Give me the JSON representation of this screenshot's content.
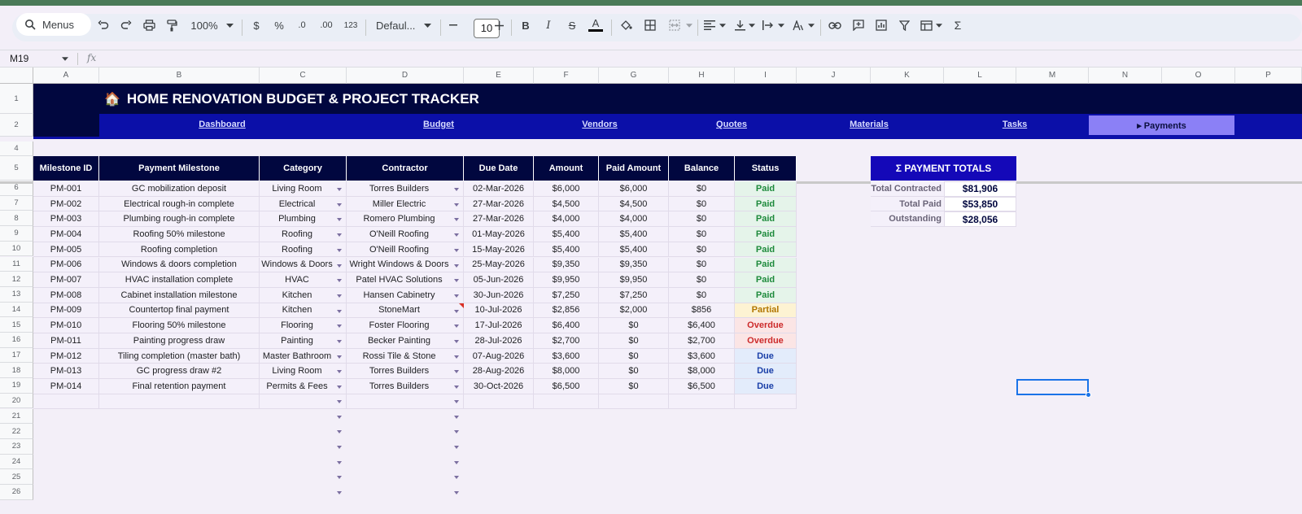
{
  "toolbar": {
    "menus_label": "Menus",
    "zoom": "100%",
    "currency": "$",
    "percent": "%",
    "dec_less": ".0",
    "dec_more": ".00",
    "format_123": "123",
    "font": "Defaul...",
    "font_size": "10",
    "bold": "B",
    "italic": "I",
    "strike": "S",
    "text_color": "A",
    "sum": "Σ"
  },
  "name_box": "M19",
  "fx_label": "fx",
  "columns": [
    "A",
    "B",
    "C",
    "D",
    "E",
    "F",
    "G",
    "H",
    "I",
    "J",
    "K",
    "L",
    "M",
    "N",
    "O",
    "P"
  ],
  "rows": [
    "1",
    "2",
    "4",
    "5",
    "6",
    "7",
    "8",
    "9",
    "10",
    "11",
    "12",
    "13",
    "14",
    "15",
    "16",
    "17",
    "18",
    "19",
    "20",
    "21",
    "22",
    "23",
    "24",
    "25",
    "26"
  ],
  "title": "HOME RENOVATION BUDGET & PROJECT TRACKER",
  "title_emoji": "🏠",
  "nav": {
    "links": [
      "Dashboard",
      "Budget",
      "Vendors",
      "Quotes",
      "Materials",
      "Tasks"
    ],
    "active": "▸ Payments"
  },
  "table": {
    "headers": [
      "Milestone ID",
      "Payment Milestone",
      "Category",
      "Contractor",
      "Due Date",
      "Amount",
      "Paid Amount",
      "Balance",
      "Status"
    ],
    "rows": [
      [
        "PM-001",
        "GC mobilization deposit",
        "Living Room",
        "Torres Builders",
        "02-Mar-2026",
        "$6,000",
        "$6,000",
        "$0",
        "Paid"
      ],
      [
        "PM-002",
        "Electrical rough-in complete",
        "Electrical",
        "Miller Electric",
        "27-Mar-2026",
        "$4,500",
        "$4,500",
        "$0",
        "Paid"
      ],
      [
        "PM-003",
        "Plumbing rough-in complete",
        "Plumbing",
        "Romero Plumbing",
        "27-Mar-2026",
        "$4,000",
        "$4,000",
        "$0",
        "Paid"
      ],
      [
        "PM-004",
        "Roofing 50% milestone",
        "Roofing",
        "O'Neill Roofing",
        "01-May-2026",
        "$5,400",
        "$5,400",
        "$0",
        "Paid"
      ],
      [
        "PM-005",
        "Roofing completion",
        "Roofing",
        "O'Neill Roofing",
        "15-May-2026",
        "$5,400",
        "$5,400",
        "$0",
        "Paid"
      ],
      [
        "PM-006",
        "Windows & doors completion",
        "Windows & Doors",
        "Wright Windows & Doors",
        "25-May-2026",
        "$9,350",
        "$9,350",
        "$0",
        "Paid"
      ],
      [
        "PM-007",
        "HVAC installation complete",
        "HVAC",
        "Patel HVAC Solutions",
        "05-Jun-2026",
        "$9,950",
        "$9,950",
        "$0",
        "Paid"
      ],
      [
        "PM-008",
        "Cabinet installation milestone",
        "Kitchen",
        "Hansen Cabinetry",
        "30-Jun-2026",
        "$7,250",
        "$7,250",
        "$0",
        "Paid"
      ],
      [
        "PM-009",
        "Countertop final payment",
        "Kitchen",
        "StoneMart",
        "10-Jul-2026",
        "$2,856",
        "$2,000",
        "$856",
        "Partial"
      ],
      [
        "PM-010",
        "Flooring 50% milestone",
        "Flooring",
        "Foster Flooring",
        "17-Jul-2026",
        "$6,400",
        "$0",
        "$6,400",
        "Overdue"
      ],
      [
        "PM-011",
        "Painting progress draw",
        "Painting",
        "Becker Painting",
        "28-Jul-2026",
        "$2,700",
        "$0",
        "$2,700",
        "Overdue"
      ],
      [
        "PM-012",
        "Tiling completion (master bath)",
        "Master Bathroom",
        "Rossi Tile & Stone",
        "07-Aug-2026",
        "$3,600",
        "$0",
        "$3,600",
        "Due"
      ],
      [
        "PM-013",
        "GC progress draw #2",
        "Living Room",
        "Torres Builders",
        "28-Aug-2026",
        "$8,000",
        "$0",
        "$8,000",
        "Due"
      ],
      [
        "PM-014",
        "Final retention payment",
        "Permits & Fees",
        "Torres Builders",
        "30-Oct-2026",
        "$6,500",
        "$0",
        "$6,500",
        "Due"
      ]
    ]
  },
  "totals": {
    "header": "Σ PAYMENT TOTALS",
    "items": [
      {
        "label": "Total Contracted",
        "value": "$81,906"
      },
      {
        "label": "Total Paid",
        "value": "$53,850"
      },
      {
        "label": "Outstanding",
        "value": "$28,056"
      }
    ]
  },
  "colors": {
    "banner": "#01073f",
    "nav": "#0b0fa8",
    "nav_active": "#8b80f6",
    "totals_header": "#1408b8"
  }
}
